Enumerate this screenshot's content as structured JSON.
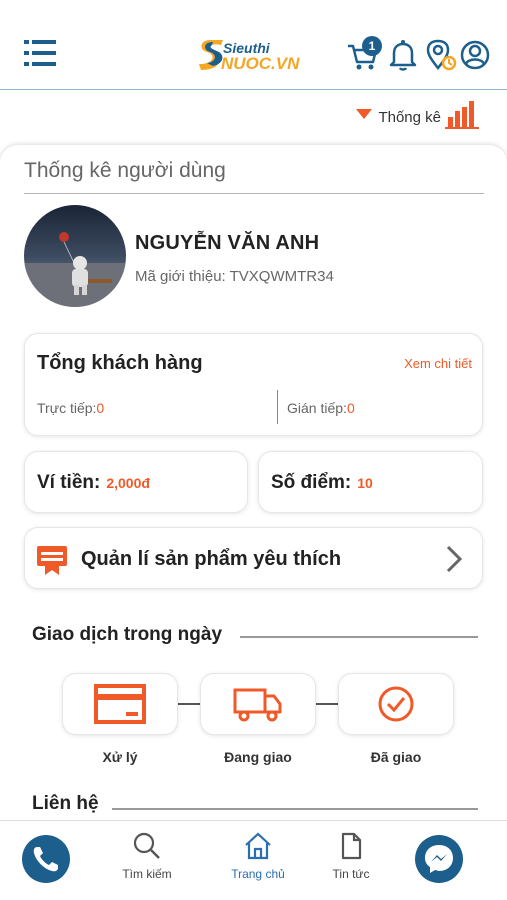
{
  "header": {
    "logo_top": "Sieuthi",
    "logo_bottom": "NUOC.VN",
    "cart_count": "1",
    "icons": [
      "menu-icon",
      "cart-icon",
      "bell-icon",
      "location-icon",
      "user-icon"
    ]
  },
  "stats_toggle": {
    "label": "Thống kê"
  },
  "card": {
    "title": "Thống kê người dùng",
    "user": {
      "name": "NGUYỄN VĂN ANH",
      "ref_label": "Mã giới thiệu:",
      "ref_code": "TVXQWMTR34"
    },
    "customers": {
      "title": "Tổng khách hàng",
      "detail_link": "Xem chi tiết",
      "direct_label": "Trực tiếp:",
      "direct_value": "0",
      "indirect_label": "Gián tiếp:",
      "indirect_value": "0"
    },
    "wallet": {
      "label": "Ví tiền:",
      "value": "2,000đ"
    },
    "points": {
      "label": "Số điểm:",
      "value": "10"
    },
    "favorites": {
      "label": "Quản lí sản phẩm yêu thích"
    },
    "transactions": {
      "heading": "Giao dịch trong ngày",
      "steps": [
        "Xử lý",
        "Đang giao",
        "Đã giao"
      ]
    },
    "contact": {
      "heading": "Liên hệ"
    }
  },
  "bottom_nav": {
    "items": [
      {
        "label": "Tìm kiếm"
      },
      {
        "label": "Trang chủ"
      },
      {
        "label": "Tin tức"
      }
    ]
  },
  "colors": {
    "accent": "#f05a28",
    "brand": "#1d5f8c",
    "active_nav": "#2a6fb1"
  }
}
